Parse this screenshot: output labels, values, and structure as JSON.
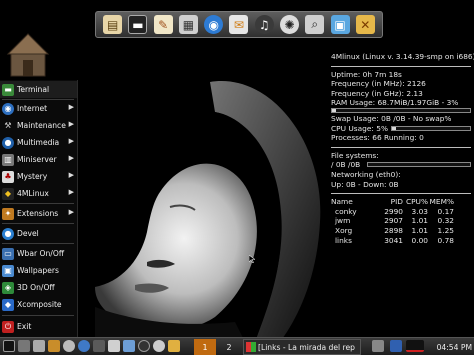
{
  "dock": {
    "icons": [
      "file-manager-icon",
      "terminal-icon",
      "text-editor-icon",
      "calculator-icon",
      "web-browser-icon",
      "mail-icon",
      "audio-player-icon",
      "video-player-icon",
      "search-icon",
      "image-viewer-icon",
      "system-tools-icon"
    ]
  },
  "menu": {
    "items": [
      {
        "label": "Terminal",
        "icon": "terminal-icon",
        "submenu": false
      },
      {
        "label": "Internet",
        "icon": "globe-icon",
        "submenu": true
      },
      {
        "label": "Maintenance",
        "icon": "wrench-icon",
        "submenu": true
      },
      {
        "label": "Multimedia",
        "icon": "multimedia-icon",
        "submenu": true
      },
      {
        "label": "Miniserver",
        "icon": "server-icon",
        "submenu": true
      },
      {
        "label": "Mystery",
        "icon": "mystery-icon",
        "submenu": true
      },
      {
        "label": "4MLinux",
        "icon": "penguin-icon",
        "submenu": true
      },
      {
        "label": "Extensions",
        "icon": "extensions-icon",
        "submenu": true
      },
      {
        "label": "Devel",
        "icon": "devel-icon",
        "submenu": false
      },
      {
        "label": "Wbar On/Off",
        "icon": "wbar-icon",
        "submenu": false
      },
      {
        "label": "Wallpapers",
        "icon": "wallpaper-icon",
        "submenu": false
      },
      {
        "label": "3D On/Off",
        "icon": "3d-icon",
        "submenu": false
      },
      {
        "label": "Xcomposite",
        "icon": "xcomposite-icon",
        "submenu": false
      },
      {
        "label": "Exit",
        "icon": "exit-icon",
        "submenu": false
      }
    ]
  },
  "conky": {
    "title": "4Mlinux (Linux v. 3.14.39-smp on i686)",
    "uptime": "Uptime: 0h 7m 18s",
    "freq_mhz": "Frequency (in MHz): 2126",
    "freq_ghz": "Frequency (in GHz): 2.13",
    "ram": "RAM Usage: 68.7MiB/1.97GiB - 3%",
    "ram_pct": 3,
    "swap": "Swap Usage: 0B /0B   - No swap%",
    "swap_pct": 0,
    "cpu": "CPU Usage: 5%",
    "cpu_pct": 5,
    "processes": "Processes: 66  Running: 0",
    "fs_label": "File systems:",
    "fs_value": "/ 0B /0B",
    "fs_pct": 0,
    "net_label": "Networking (eth0):",
    "net_value": "Up: 0B  - Down: 0B",
    "proc_header": {
      "name": "Name",
      "pid": "PID",
      "cpu": "CPU%",
      "mem": "MEM%"
    },
    "procs": [
      {
        "name": "conky",
        "pid": "2990",
        "cpu": "3.03",
        "mem": "0.17"
      },
      {
        "name": "jwm",
        "pid": "2907",
        "cpu": "1.01",
        "mem": "0.32"
      },
      {
        "name": "Xorg",
        "pid": "2898",
        "cpu": "1.01",
        "mem": "1.25"
      },
      {
        "name": "links",
        "pid": "3041",
        "cpu": "0.00",
        "mem": "0.78"
      }
    ]
  },
  "taskbar": {
    "workspace1": "1",
    "workspace2": "2",
    "task_title": "[Links - La mirada del rep",
    "clock": "04:54 PM"
  },
  "colors": {
    "workspace_active": "#c06a10",
    "panel_bg": "#0a0a0a"
  }
}
